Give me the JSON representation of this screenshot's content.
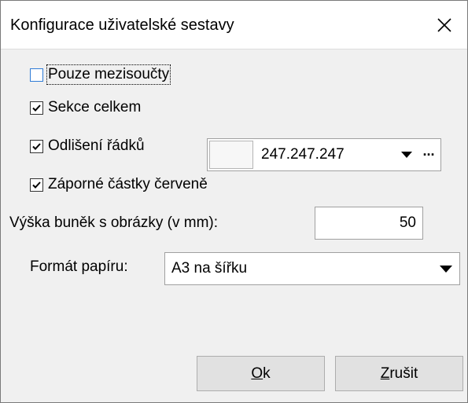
{
  "window": {
    "title": "Konfigurace uživatelské sestavy",
    "close_icon": "close-icon"
  },
  "options": {
    "subtotals_only": {
      "label": "Pouze mezisoučty",
      "checked": false
    },
    "section_totals": {
      "label": "Sekce celkem",
      "checked": true
    },
    "row_highlight": {
      "label": "Odlišení řádků",
      "checked": true
    },
    "negative_red": {
      "label": "Záporné částky červeně",
      "checked": true
    }
  },
  "row_color": {
    "value": "247.247.247",
    "swatch_color": "#f7f7f7",
    "more_label": "···"
  },
  "image_cell_height": {
    "label": "Výška buněk s obrázky (v mm):",
    "value": "50"
  },
  "paper_format": {
    "label": "Formát papíru:",
    "value": "A3 na šířku"
  },
  "buttons": {
    "ok": {
      "mnemonic": "O",
      "rest": "k"
    },
    "cancel": {
      "mnemonic": "Z",
      "rest": "rušit"
    }
  },
  "colors": {
    "client_bg": "#f0f0f0",
    "button_bg": "#e1e1e1",
    "unchecked_border": "#2f7bd6"
  }
}
